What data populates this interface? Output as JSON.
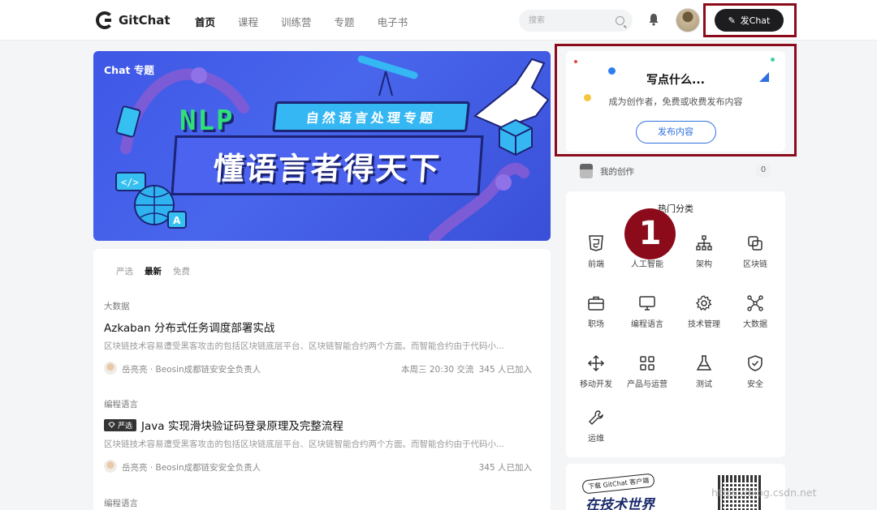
{
  "header": {
    "logo_text": "GitChat",
    "nav": [
      {
        "label": "首页",
        "active": true
      },
      {
        "label": "课程",
        "active": false
      },
      {
        "label": "训练营",
        "active": false
      },
      {
        "label": "专题",
        "active": false
      },
      {
        "label": "电子书",
        "active": false
      }
    ],
    "search_placeholder": "搜索",
    "publish_chat_label": "发Chat"
  },
  "banner": {
    "tag": "Chat 专题",
    "nlp": "NLP",
    "subtitle": "自然语言处理专题",
    "title": "懂语言者得天下"
  },
  "feed": {
    "tabs": [
      {
        "label": "严选",
        "active": false
      },
      {
        "label": "最新",
        "active": true
      },
      {
        "label": "免费",
        "active": false
      }
    ],
    "articles": [
      {
        "category": "大数据",
        "badge": "",
        "title": "Azkaban 分布式任务调度部署实战",
        "desc": "区块链技术容易遭受黑客攻击的包括区块链底层平台、区块链智能合约两个方面。而智能合约由于代码小...",
        "author": "岳亮亮 · Beosin成都链安安全负责人",
        "time": "本周三 20:30 交流",
        "joined": "345 人已加入"
      },
      {
        "category": "编程语言",
        "badge": "严选",
        "title": "Java 实现滑块验证码登录原理及完整流程",
        "desc": "区块链技术容易遭受黑客攻击的包括区块链底层平台、区块链智能合约两个方面。而智能合约由于代码小...",
        "author": "岳亮亮 · Beosin成都链安安全负责人",
        "time": "",
        "joined": "345 人已加入"
      },
      {
        "category": "编程语言"
      }
    ]
  },
  "publish_card": {
    "title": "写点什么...",
    "subtitle": "成为创作者，免费或收费发布内容",
    "button": "发布内容"
  },
  "my_creations": {
    "label": "我的创作",
    "count": "0"
  },
  "categories": {
    "title": "热门分类",
    "items": [
      {
        "label": "前端",
        "icon": "html5-icon"
      },
      {
        "label": "人工智能",
        "icon": "ai-icon"
      },
      {
        "label": "架构",
        "icon": "architecture-icon"
      },
      {
        "label": "区块链",
        "icon": "blockchain-icon"
      },
      {
        "label": "职场",
        "icon": "briefcase-icon"
      },
      {
        "label": "编程语言",
        "icon": "monitor-icon"
      },
      {
        "label": "技术管理",
        "icon": "gear-icon"
      },
      {
        "label": "大数据",
        "icon": "network-icon"
      },
      {
        "label": "移动开发",
        "icon": "move-icon"
      },
      {
        "label": "产品与运营",
        "icon": "grid-icon"
      },
      {
        "label": "测试",
        "icon": "flask-icon"
      },
      {
        "label": "安全",
        "icon": "shield-icon"
      },
      {
        "label": "运维",
        "icon": "wrench-icon"
      }
    ]
  },
  "annotation": {
    "marker": "1"
  },
  "download": {
    "tag": "下载 GitChat 客户端",
    "title": "在技术世界"
  },
  "watermark": "https://blog.csdn.net",
  "colors": {
    "accent": "#2f6fe0",
    "highlight": "#8b0b1a",
    "button_dark": "#1d1d1f"
  }
}
